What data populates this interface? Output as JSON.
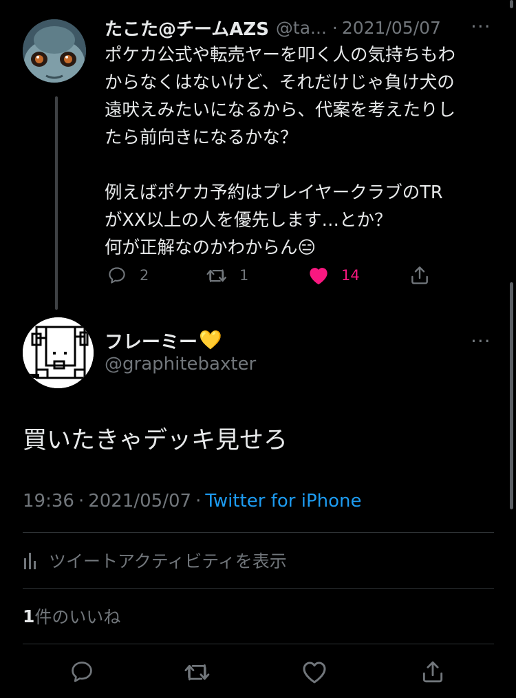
{
  "parent_tweet": {
    "display_name": "たこた@チームAZS",
    "handle": "@ta...",
    "separator": "·",
    "date": "2021/05/07",
    "more_label": "···",
    "text": "ポケカ公式や転売ヤーを叩く人の気持ちもわ\nからなくはないけど、それだけじゃ負け犬の\n遠吠えみたいになるから、代案を考えたりし\nたら前向きになるかな？\n\n例えばポケカ予約はプレイヤークラブのTR\nがXX以上の人を優先します…とか？\n何が正解なのかわからん😑",
    "counts": {
      "replies": "2",
      "retweets": "1",
      "likes": "14"
    },
    "avatar_icon": "cartoon-creature-avatar"
  },
  "main_tweet": {
    "display_name": "フレーミー",
    "name_emoji": "💛",
    "handle": "@graphitebaxter",
    "more_label": "···",
    "text": "買いたきゃデッキ見せろ",
    "time": "19:36",
    "separator": "·",
    "date": "2021/05/07",
    "separator2": "·",
    "source": "Twitter for iPhone",
    "activity_label": "ツイートアクティビティを表示",
    "likes_count": "1",
    "likes_label": "件のいいね",
    "avatar_icon": "line-art-dog-avatar"
  },
  "colors": {
    "background": "#000000",
    "text": "#e7e9ea",
    "muted": "#71767b",
    "link": "#1d9bf0",
    "like": "#f91880"
  }
}
